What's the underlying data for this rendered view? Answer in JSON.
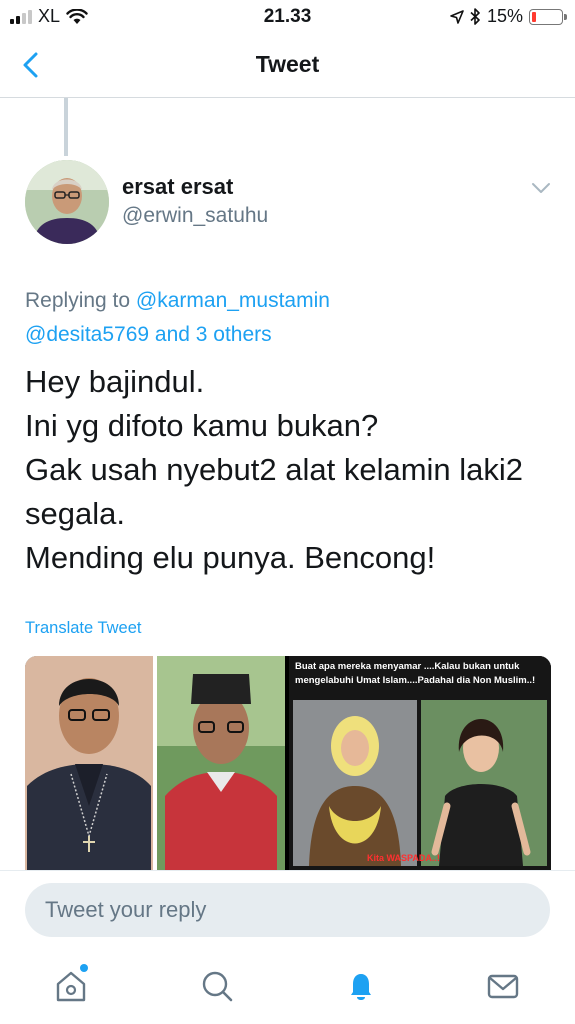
{
  "status_bar": {
    "carrier": "XL",
    "time": "21.33",
    "battery_percent": "15%",
    "battery_level": 0.15,
    "signal_bars_active": 2,
    "signal_bars_total": 4
  },
  "nav": {
    "title": "Tweet"
  },
  "tweet": {
    "author_name": "ersat ersat",
    "author_handle": "@erwin_satuhu",
    "replying_prefix": "Replying to ",
    "reply_mention_1": "@karman_mustamin",
    "reply_mention_2": "@desita5769 and 3 others",
    "text_lines": [
      "Hey bajindul.",
      "Ini yg difoto kamu bukan?",
      "Gak usah nyebut2 alat kelamin laki2",
      "segala.",
      "Mending elu punya. Bencong!"
    ],
    "translate_label": "Translate Tweet",
    "media": {
      "overlay_text": "Buat apa mereka menyamar ....Kalau bukan untuk mengelabuhi Umat Islam....Padahal  dia Non Muslim..!",
      "stamp_text": "Kita WASPADA..!"
    }
  },
  "reply": {
    "placeholder": "Tweet your reply"
  },
  "tab_bar": {
    "items": [
      "home-icon",
      "search-icon",
      "notifications-icon",
      "messages-icon"
    ]
  },
  "colors": {
    "accent": "#1da1f2",
    "secondary_text": "#657786",
    "battery_low": "#ff3b30"
  }
}
